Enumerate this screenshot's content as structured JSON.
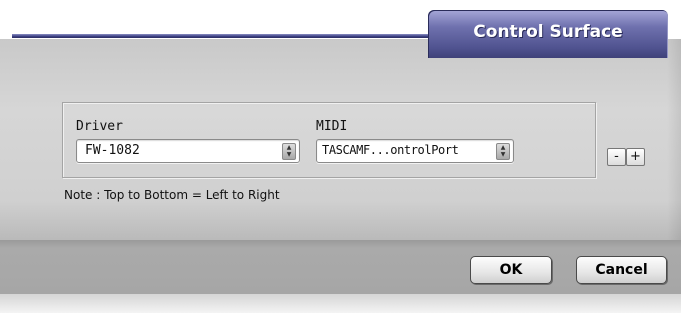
{
  "dialog": {
    "title": "Control Surface",
    "driver": {
      "label": "Driver",
      "value": "FW-1082"
    },
    "midi": {
      "label": "MIDI",
      "value": "TASCAMF...ontrolPort"
    },
    "remove_label": "-",
    "add_label": "+",
    "note": "Note : Top to Bottom = Left to Right",
    "ok_label": "OK",
    "cancel_label": "Cancel"
  },
  "colors": {
    "title_bar": "#5a5c9c",
    "panel": "#d0d0d0",
    "footer": "#a6a6a6"
  }
}
